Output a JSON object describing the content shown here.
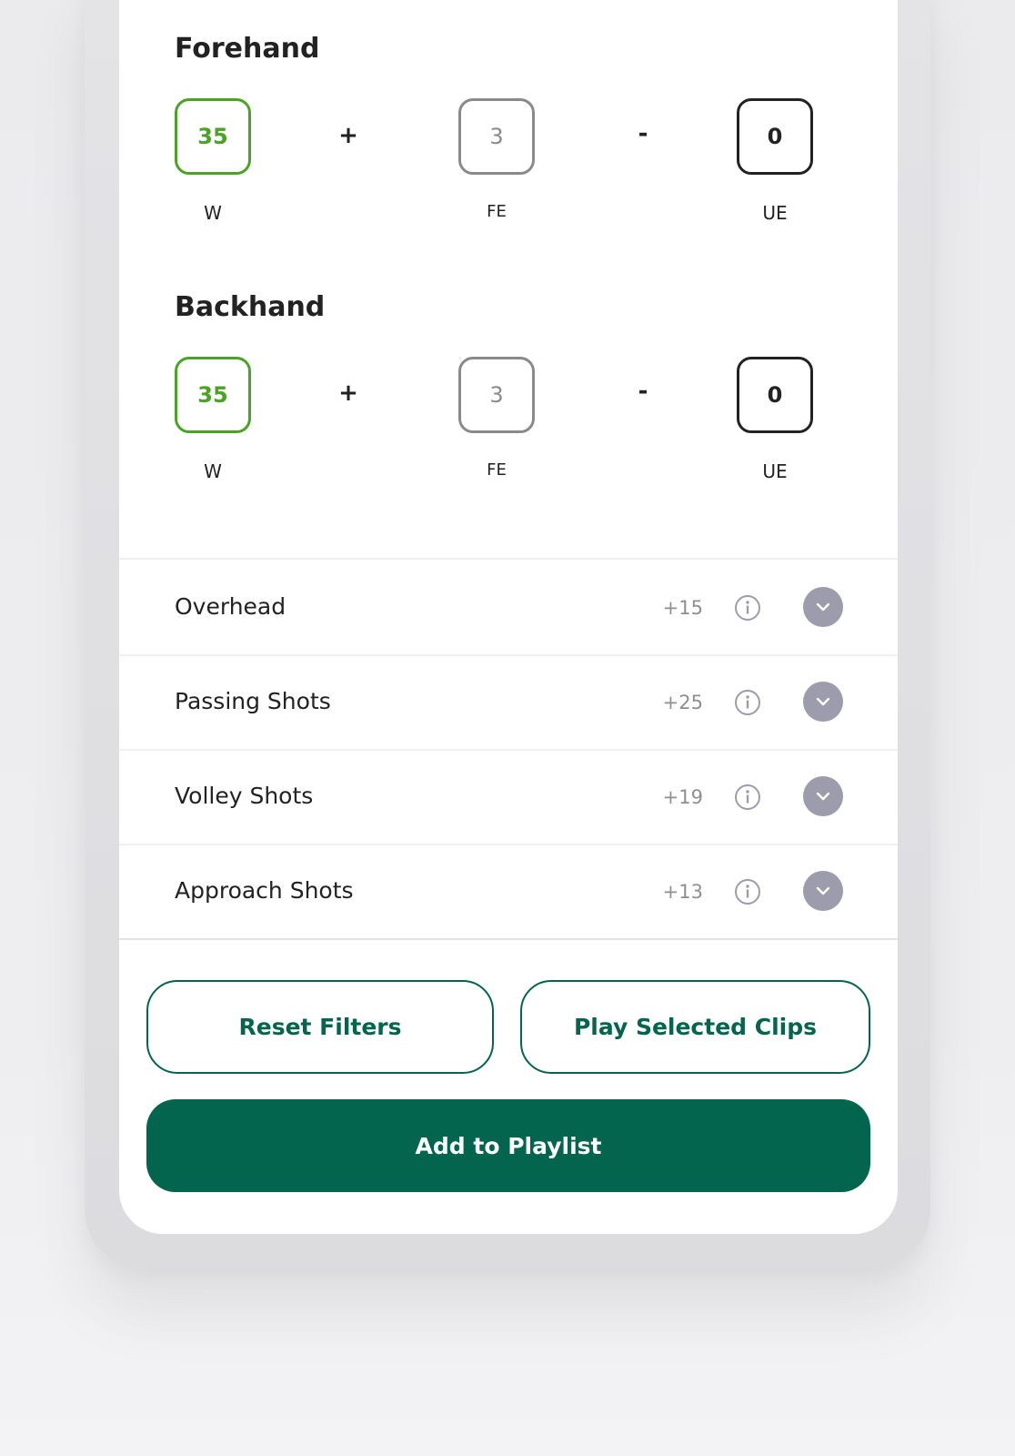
{
  "forehand": {
    "title": "Forehand",
    "winners": "35",
    "forced_errors": "3",
    "unforced_errors": "0",
    "plus": "+",
    "minus": "-",
    "labels": {
      "w": "W",
      "fe": "FE",
      "ue": "UE"
    }
  },
  "backhand": {
    "title": "Backhand",
    "winners": "35",
    "forced_errors": "3",
    "unforced_errors": "0",
    "plus": "+",
    "minus": "-",
    "labels": {
      "w": "W",
      "fe": "FE",
      "ue": "UE"
    }
  },
  "shot_categories": [
    {
      "label": "Overhead",
      "count": "+15"
    },
    {
      "label": "Passing Shots",
      "count": "+25"
    },
    {
      "label": "Volley Shots",
      "count": "+19"
    },
    {
      "label": "Approach Shots",
      "count": "+13"
    }
  ],
  "actions": {
    "reset_filters": "Reset Filters",
    "play_selected_clips": "Play Selected Clips",
    "add_to_playlist": "Add to Playlist"
  },
  "colors": {
    "winner_green": "#4aa322",
    "brand_teal": "#03654e",
    "muted_gray": "#8e8e96",
    "expand_button": "#9d9cad"
  }
}
